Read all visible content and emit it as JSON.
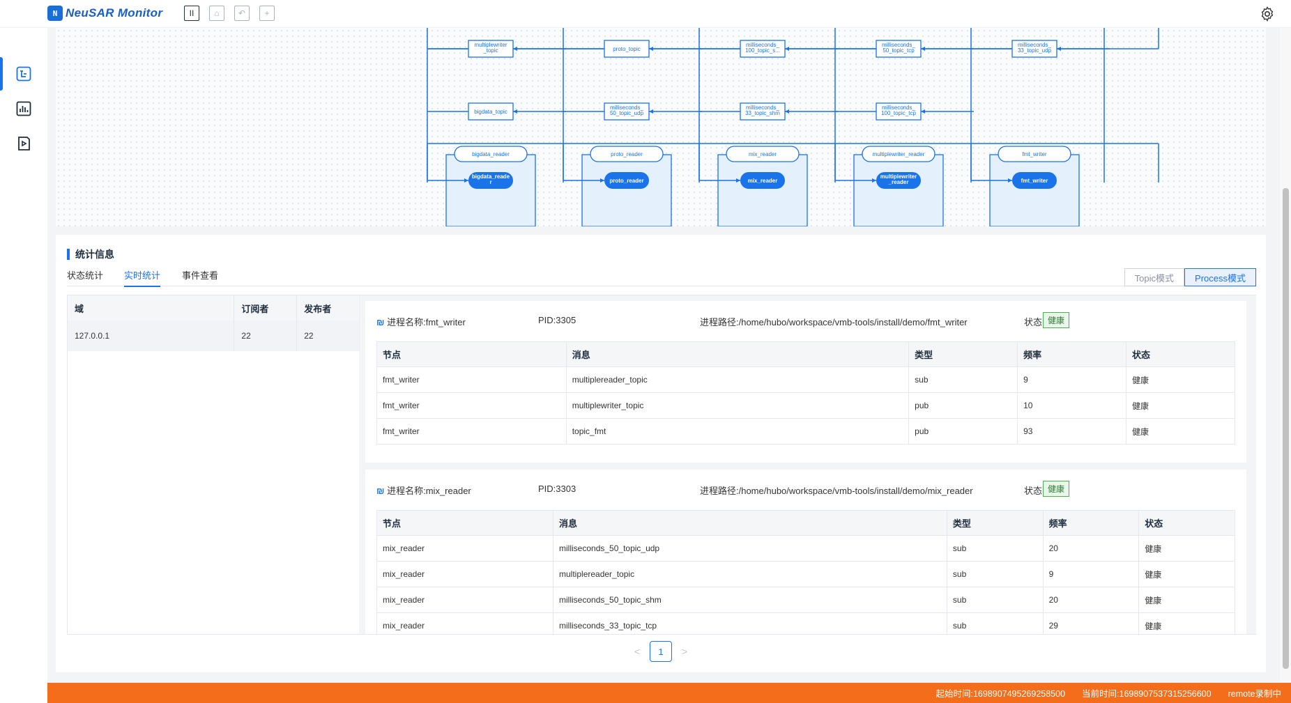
{
  "app": {
    "logo_mark": "N",
    "title": "NeuSAR Monitor"
  },
  "toolbar": [
    {
      "name": "pause-icon",
      "glyph": "II",
      "active": true
    },
    {
      "name": "monitor-icon",
      "glyph": "⌂",
      "active": false
    },
    {
      "name": "undo-icon",
      "glyph": "↶",
      "active": false
    },
    {
      "name": "add-icon",
      "glyph": "+",
      "active": false
    }
  ],
  "graph": {
    "topic_nodes": [
      {
        "label": [
          "multiplewriter",
          "_topic"
        ]
      },
      {
        "label": [
          "proto_topic"
        ]
      },
      {
        "label": [
          "milliseconds_",
          "100_topic_s..."
        ]
      },
      {
        "label": [
          "milliseconds_",
          "50_topic_tcp"
        ]
      },
      {
        "label": [
          "milliseconds_",
          "33_topic_udp"
        ]
      },
      {
        "label": [
          "bigdata_topic"
        ]
      },
      {
        "label": [
          "milliseconds_",
          "50_topic_udp"
        ]
      },
      {
        "label": [
          "milliseconds_",
          "33_topic_shm"
        ]
      },
      {
        "label": [
          "milliseconds_",
          "100_topic_tcp"
        ]
      }
    ],
    "process_nodes": [
      {
        "pill": "bigdata_reader",
        "node": [
          "bigdata_reade",
          "r"
        ]
      },
      {
        "pill": "proto_reader",
        "node": [
          "proto_reader"
        ]
      },
      {
        "pill": "mix_reader",
        "node": [
          "mix_reader"
        ]
      },
      {
        "pill": "multiplewriter_reader",
        "node": [
          "multiplewriter",
          "_reader"
        ]
      },
      {
        "pill": "fmt_writer",
        "node": [
          "fmt_writer"
        ]
      }
    ]
  },
  "stats": {
    "title": "统计信息",
    "tabs": [
      "状态统计",
      "实时统计",
      "事件查看"
    ],
    "active_tab": 1,
    "modes": [
      "Topic模式",
      "Process模式"
    ],
    "active_mode": 1
  },
  "domain_table": {
    "headers": [
      "域",
      "订阅者",
      "发布者"
    ],
    "rows": [
      [
        "127.0.0.1",
        "22",
        "22"
      ]
    ]
  },
  "processes": [
    {
      "name": "进程名称:fmt_writer",
      "pid": "PID:3305",
      "path": "进程路径:/home/hubo/workspace/vmb-tools/install/demo/fmt_writer",
      "status_label": "状态:",
      "status": "健康",
      "headers": [
        "节点",
        "消息",
        "类型",
        "频率",
        "状态"
      ],
      "rows": [
        [
          "fmt_writer",
          "multiplereader_topic",
          "sub",
          "9",
          "健康"
        ],
        [
          "fmt_writer",
          "multiplewriter_topic",
          "pub",
          "10",
          "健康"
        ],
        [
          "fmt_writer",
          "topic_fmt",
          "pub",
          "93",
          "健康"
        ]
      ]
    },
    {
      "name": "进程名称:mix_reader",
      "pid": "PID:3303",
      "path": "进程路径:/home/hubo/workspace/vmb-tools/install/demo/mix_reader",
      "status_label": "状态:",
      "status": "健康",
      "headers": [
        "节点",
        "消息",
        "类型",
        "频率",
        "状态"
      ],
      "rows": [
        [
          "mix_reader",
          "milliseconds_50_topic_udp",
          "sub",
          "20",
          "健康"
        ],
        [
          "mix_reader",
          "multiplereader_topic",
          "sub",
          "9",
          "健康"
        ],
        [
          "mix_reader",
          "milliseconds_50_topic_shm",
          "sub",
          "20",
          "健康"
        ],
        [
          "mix_reader",
          "milliseconds_33_topic_tcp",
          "sub",
          "29",
          "健康"
        ]
      ]
    }
  ],
  "pagination": {
    "prev": "<",
    "current": "1",
    "next": ">"
  },
  "statusbar": {
    "start": "起始时间:1698907495269258500",
    "current": "当前时间:1698907537315256600",
    "mode": "remote录制中"
  },
  "colors": {
    "accent": "#1a73e8",
    "statusbar": "#f46d1a",
    "healthy": "#2e7d32"
  }
}
